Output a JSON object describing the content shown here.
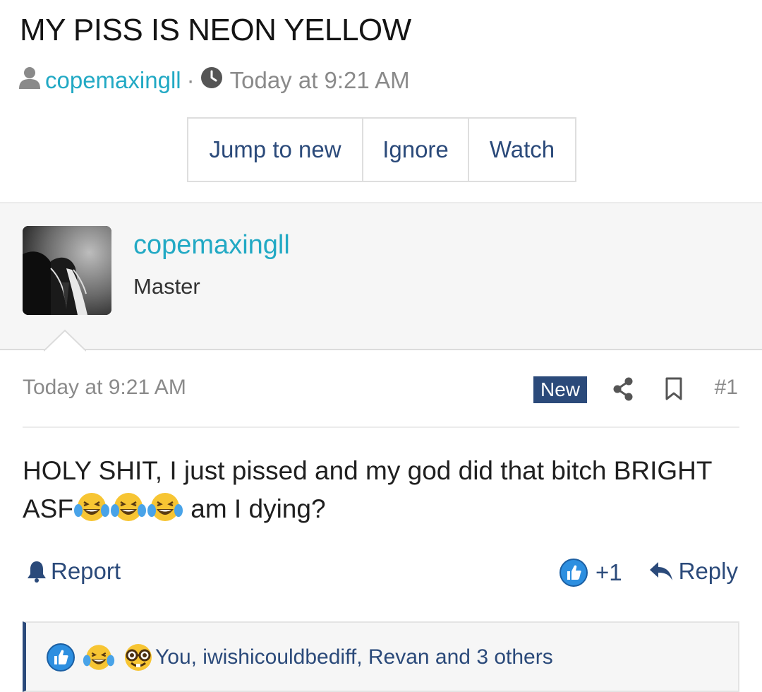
{
  "thread": {
    "title": "MY PISS IS NEON YELLOW",
    "author": "copemaxingll",
    "separator": "·",
    "time": "Today at 9:21 AM"
  },
  "thread_buttons": {
    "jump": "Jump to new",
    "ignore": "Ignore",
    "watch": "Watch"
  },
  "post": {
    "username": "copemaxingll",
    "user_title": "Master",
    "time": "Today at 9:21 AM",
    "badge": "New",
    "number": "#1",
    "text_line1": "HOLY SHIT, I just pissed and my god did that bitch BRIGHT",
    "text_line2_prefix": "ASF",
    "text_line2_suffix": " am I dying?"
  },
  "actions": {
    "report": "Report",
    "reaction_count": "+1",
    "reply": "Reply"
  },
  "reactions": {
    "summary": "You, iwishicouldbediff, Revan and 3 others",
    "icons": [
      "like-icon",
      "laughing-crying-icon",
      "nerd-icon"
    ]
  },
  "colors": {
    "accent": "#22a9c4",
    "link": "#2b4a7a",
    "badge": "#2b4a7a",
    "muted": "#8a8a8a"
  }
}
